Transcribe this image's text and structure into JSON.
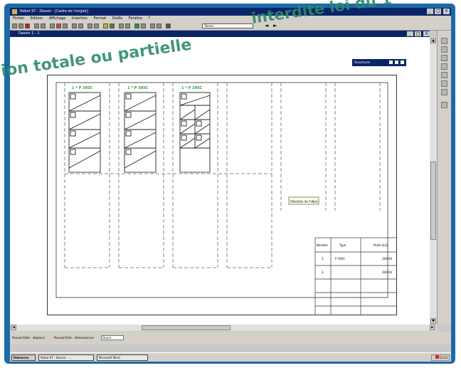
{
  "app": {
    "title": "Robot 97 - Dessin - [Cadre de l'onglet]",
    "window_controls": [
      "_",
      "□",
      "×"
    ]
  },
  "menu": [
    "Fichier",
    "Edition",
    "Affichage",
    "Insertion",
    "Format",
    "Outils",
    "Fenêtre",
    "?"
  ],
  "toolbar": {
    "dropdown_value": "Tolerie",
    "nav_prev": "◄",
    "nav_next": "►"
  },
  "child_window": {
    "title": "Dessin 1 : 1",
    "controls": [
      "_",
      "□",
      "×"
    ]
  },
  "palette": {
    "title": "Ouvertures"
  },
  "watermark": {
    "line1": "ion totale ou partielle",
    "line2": "interdite loi du 1"
  },
  "sheet": {
    "panel_labels": [
      "1 * P 395C",
      "1 * P 395C",
      "1 * P 395C"
    ],
    "selection_tag": "Sélection de l'objet",
    "table": {
      "headers": [
        "Nombre",
        "Type",
        "Poids (kG)"
      ],
      "rows": [
        [
          "3",
          "P 395C",
          "260.94"
        ],
        [
          "3",
          "",
          "260.94"
        ],
        [
          "",
          "",
          ""
        ],
        [
          "",
          "",
          ""
        ],
        [
          "",
          "",
          ""
        ],
        [
          "",
          "",
          ""
        ]
      ]
    }
  },
  "statusbar": {
    "left": "Pouvoir/Vide : déplacer",
    "middle": "Pouvoir/Vide : dimensionner",
    "input": "Ouvrir"
  },
  "taskbar": {
    "start": "Démarrer",
    "tasks": [
      "Robot 97 - Dessin - ...",
      "Microsoft Word"
    ],
    "clock": "10:24"
  },
  "colors": {
    "frame": "#1b6aa8",
    "titlebar": "#0a246a",
    "panel_label": "#2e9b4a",
    "watermark": "#2e8b6a"
  }
}
